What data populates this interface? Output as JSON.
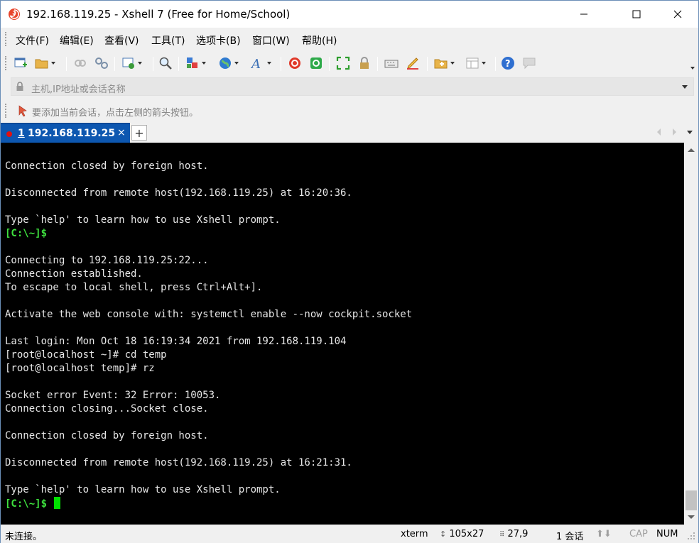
{
  "window": {
    "title": "192.168.119.25 - Xshell 7 (Free for Home/School)"
  },
  "menu": {
    "items": [
      "文件(F)",
      "编辑(E)",
      "查看(V)",
      "工具(T)",
      "选项卡(B)",
      "窗口(W)",
      "帮助(H)"
    ]
  },
  "toolbar": {
    "icons": [
      "new-session-icon",
      "open-folder-icon",
      "reconnect-icon",
      "disconnect-icon",
      "properties-icon",
      "search-icon",
      "copy-paste-icon",
      "globe-icon",
      "font-icon",
      "xftp-icon",
      "xshell-green-icon",
      "fullscreen-icon",
      "lock-icon",
      "keyboard-icon",
      "highlight-icon",
      "new-folder-icon",
      "layout-icon",
      "help-icon",
      "chat-icon"
    ]
  },
  "address": {
    "placeholder": "主机,IP地址或会话名称"
  },
  "hint": {
    "text": "要添加当前会话，点击左侧的箭头按钮。"
  },
  "tabs": [
    {
      "number": "1",
      "label": "192.168.119.25",
      "close": "×",
      "active": true
    }
  ],
  "tab_add": "+",
  "terminal": {
    "lines": [
      {
        "text": "Connection closed by foreign host."
      },
      {
        "text": ""
      },
      {
        "text": "Disconnected from remote host(192.168.119.25) at 16:20:36."
      },
      {
        "text": ""
      },
      {
        "text": "Type `help' to learn how to use Xshell prompt."
      },
      {
        "text": "[C:\\~]$",
        "prompt": true
      },
      {
        "text": ""
      },
      {
        "text": "Connecting to 192.168.119.25:22..."
      },
      {
        "text": "Connection established."
      },
      {
        "text": "To escape to local shell, press Ctrl+Alt+]."
      },
      {
        "text": ""
      },
      {
        "text": "Activate the web console with: systemctl enable --now cockpit.socket"
      },
      {
        "text": ""
      },
      {
        "text": "Last login: Mon Oct 18 16:19:34 2021 from 192.168.119.104"
      },
      {
        "text": "[root@localhost ~]# cd temp"
      },
      {
        "text": "[root@localhost temp]# rz"
      },
      {
        "text": ""
      },
      {
        "text": "Socket error Event: 32 Error: 10053."
      },
      {
        "text": "Connection closing...Socket close."
      },
      {
        "text": ""
      },
      {
        "text": "Connection closed by foreign host."
      },
      {
        "text": ""
      },
      {
        "text": "Disconnected from remote host(192.168.119.25) at 16:21:31."
      },
      {
        "text": ""
      },
      {
        "text": "Type `help' to learn how to use Xshell prompt."
      },
      {
        "text": "[C:\\~]$ ",
        "prompt": true,
        "cursor": true
      }
    ]
  },
  "status": {
    "connection": "未连接。",
    "term_type": "xterm",
    "size": "105x27",
    "cursor_pos": "27,9",
    "sessions": "1 会话",
    "caps": "CAP",
    "num": "NUM"
  },
  "colors": {
    "tab_active": "#0d57b0",
    "prompt": "#3ee03e",
    "cursor": "#00e000",
    "terminal_bg": "#000000",
    "terminal_fg": "#e6e6e6"
  }
}
